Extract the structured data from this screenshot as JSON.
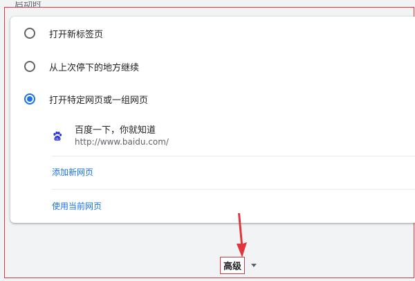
{
  "section": {
    "heading": "启动时"
  },
  "startup_options": [
    {
      "label": "打开新标签页",
      "checked": false
    },
    {
      "label": "从上次停下的地方继续",
      "checked": false
    },
    {
      "label": "打开特定网页或一组网页",
      "checked": true
    }
  ],
  "site": {
    "title": "百度一下，你就知道",
    "url": "http://www.baidu.com/",
    "icon": "baidu-paw-icon"
  },
  "links": {
    "add_page": "添加新网页",
    "use_current": "使用当前网页"
  },
  "advanced": {
    "label": "高级",
    "icon": "chevron-down-icon"
  },
  "colors": {
    "accent": "#1a73e8",
    "annotation_red": "#e0353c",
    "baidu_blue": "#2932e1"
  }
}
